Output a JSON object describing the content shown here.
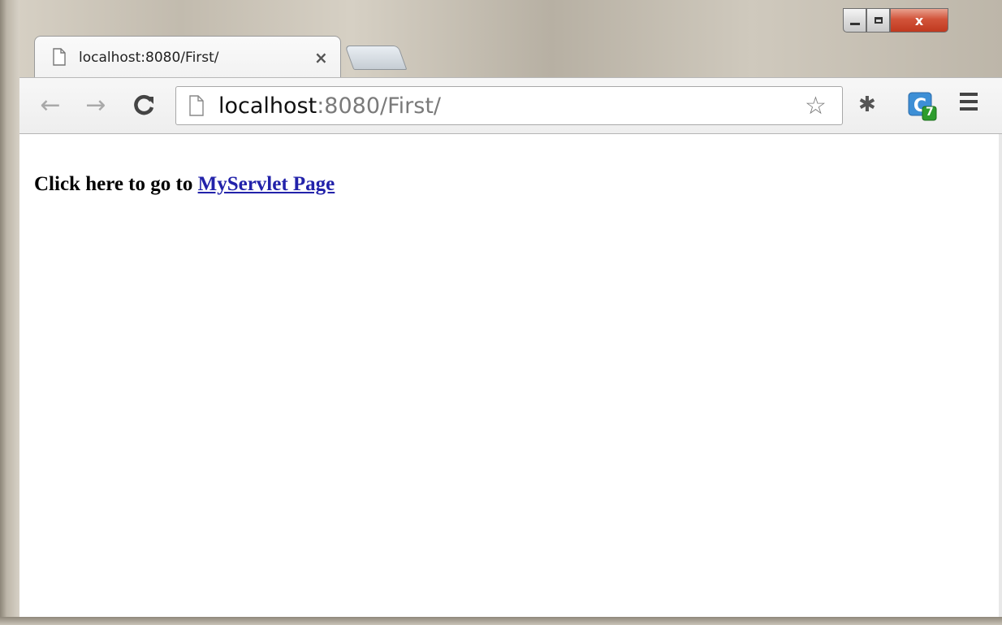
{
  "window": {
    "close_label": "x"
  },
  "tab": {
    "title": "localhost:8080/First/",
    "close_label": "×"
  },
  "toolbar": {
    "back_label": "←",
    "forward_label": "→",
    "reload_label": "C",
    "url_host": "localhost",
    "url_rest": ":8080/First/",
    "bookmark_icon": "star-outline-icon",
    "extension_badge": "7"
  },
  "page": {
    "text": "Click here to go to",
    "link_text": "MyServlet Page"
  },
  "colors": {
    "link": "#2222aa",
    "close_button": "#c7432a"
  }
}
